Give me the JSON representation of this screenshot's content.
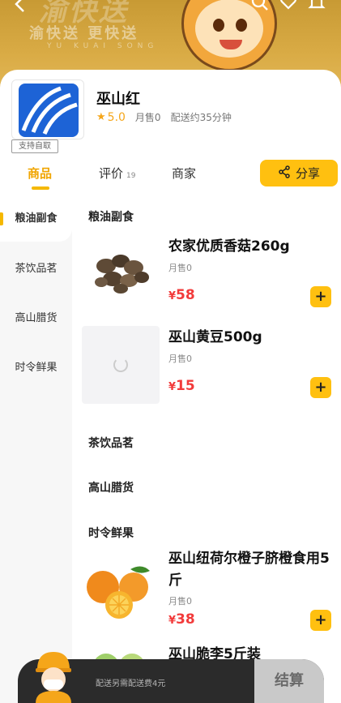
{
  "banner": {
    "brand_big": "渝快送",
    "slogan": "渝快送 更快送",
    "pinyin": "YU KUAI SONG",
    "icons": [
      "back-icon",
      "search-icon",
      "heart-icon",
      "bell-icon"
    ]
  },
  "shop": {
    "name": "巫山红",
    "rating": "5.0",
    "monthly_sales": "月售0",
    "delivery_time": "配送约35分钟",
    "pickup_badge": "支持自取"
  },
  "tabs": [
    {
      "label": "商品",
      "active": true
    },
    {
      "label": "评价",
      "count": "19"
    },
    {
      "label": "商家"
    }
  ],
  "share_label": "分享",
  "sidebar": [
    {
      "label": "粮油副食",
      "active": true
    },
    {
      "label": "茶饮品茗"
    },
    {
      "label": "高山腊货"
    },
    {
      "label": "时令鲜果"
    }
  ],
  "sections": {
    "grain": "粮油副食",
    "tea": "茶饮品茗",
    "cured": "高山腊货",
    "fruit": "时令鲜果"
  },
  "products": [
    {
      "name": "农家优质香菇260g",
      "sales": "月售0",
      "currency": "¥",
      "price": "58"
    },
    {
      "name": "巫山黄豆500g",
      "sales": "月售0",
      "currency": "¥",
      "price": "15"
    },
    {
      "name": "巫山纽荷尔橙子脐橙食用5斤",
      "sales": "月售0",
      "currency": "¥",
      "price": "38"
    },
    {
      "name": "巫山脆李5斤装"
    }
  ],
  "cart": {
    "fee_text": "配送另需配送费4元",
    "checkout_label": "结算"
  },
  "colors": {
    "accent": "#ffc010",
    "price": "#f23b3b",
    "rating": "#f5a61a",
    "banner": "#d9ab45"
  }
}
